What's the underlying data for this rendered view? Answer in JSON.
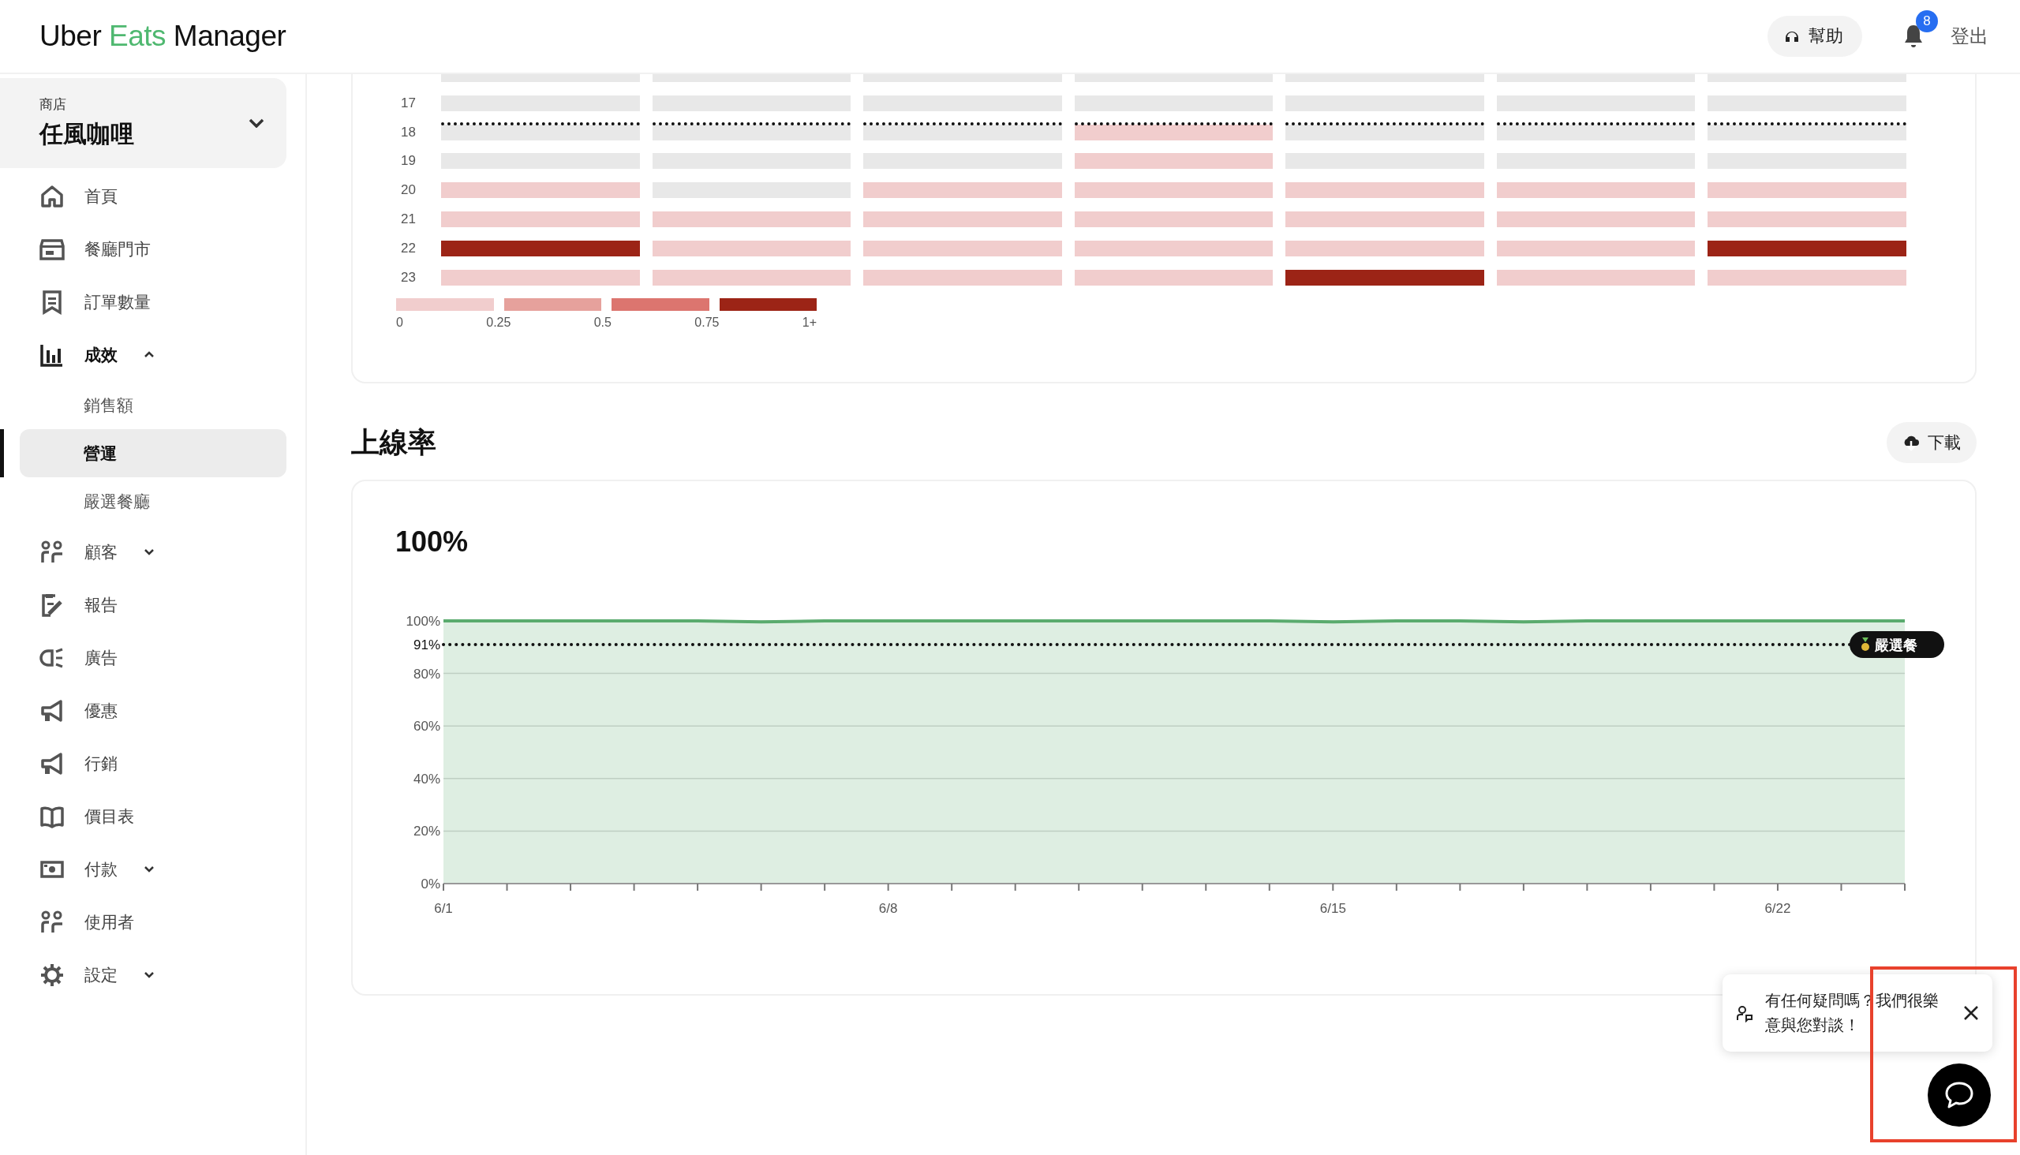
{
  "header": {
    "logo": [
      {
        "text": "Uber",
        "accent": false
      },
      {
        "text": "Eats",
        "accent": true
      },
      {
        "text": "Manager",
        "accent": false
      }
    ],
    "help_button": "幫助",
    "notifications": {
      "count": "8"
    },
    "logout": "登出"
  },
  "sidebar": {
    "store": {
      "label": "商店",
      "name": "任風咖哩"
    },
    "items": [
      {
        "label": "首頁"
      },
      {
        "label": "餐廳門市"
      },
      {
        "label": "訂單數量"
      },
      {
        "label": "成效",
        "expanded": true,
        "children": [
          {
            "label": "銷售額",
            "selected": false
          },
          {
            "label": "營運",
            "selected": true
          },
          {
            "label": "嚴選餐廳",
            "selected": false
          }
        ]
      },
      {
        "label": "顧客",
        "expanded": false
      },
      {
        "label": "報告"
      },
      {
        "label": "廣告"
      },
      {
        "label": "優惠"
      },
      {
        "label": "行銷"
      },
      {
        "label": "價目表"
      },
      {
        "label": "付款",
        "expanded": false
      },
      {
        "label": "使用者"
      },
      {
        "label": "設定",
        "expanded": false
      }
    ]
  },
  "heatmap": {
    "rows": [
      {
        "kind": "partial",
        "threshold": false,
        "cells": [
          {
            "color": "#e8e8e8"
          },
          {
            "color": "#e8e8e8"
          },
          {
            "color": "#e8e8e8"
          },
          {
            "color": "#e8e8e8"
          },
          {
            "color": "#e8e8e8"
          },
          {
            "color": "#e8e8e8"
          },
          {
            "color": "#e8e8e8"
          }
        ]
      },
      {
        "kind": "full",
        "hour": "17",
        "threshold": false,
        "cells": [
          {
            "color": "#e8e8e8"
          },
          {
            "color": "#e8e8e8"
          },
          {
            "color": "#e8e8e8"
          },
          {
            "color": "#e8e8e8"
          },
          {
            "color": "#e8e8e8"
          },
          {
            "color": "#e8e8e8"
          },
          {
            "color": "#e8e8e8"
          }
        ]
      },
      {
        "kind": "full",
        "hour": "18",
        "threshold": true,
        "cells": [
          {
            "color": "#e8e8e8"
          },
          {
            "color": "#e8e8e8"
          },
          {
            "color": "#e8e8e8"
          },
          {
            "color": "#f1cdcd"
          },
          {
            "color": "#e8e8e8"
          },
          {
            "color": "#e8e8e8"
          },
          {
            "color": "#e8e8e8"
          }
        ]
      },
      {
        "kind": "full",
        "hour": "19",
        "threshold": false,
        "cells": [
          {
            "color": "#e8e8e8"
          },
          {
            "color": "#e8e8e8"
          },
          {
            "color": "#e8e8e8"
          },
          {
            "color": "#f1cdcd"
          },
          {
            "color": "#e8e8e8"
          },
          {
            "color": "#e8e8e8"
          },
          {
            "color": "#e8e8e8"
          }
        ]
      },
      {
        "kind": "full",
        "hour": "20",
        "threshold": false,
        "cells": [
          {
            "color": "#f1cdcd"
          },
          {
            "color": "#e8e8e8"
          },
          {
            "color": "#f1cdcd"
          },
          {
            "color": "#f1cdcd"
          },
          {
            "color": "#f1cdcd"
          },
          {
            "color": "#f1cdcd"
          },
          {
            "color": "#f1cdcd"
          }
        ]
      },
      {
        "kind": "full",
        "hour": "21",
        "threshold": false,
        "cells": [
          {
            "color": "#f1cdcd"
          },
          {
            "color": "#f1cdcd"
          },
          {
            "color": "#f1cdcd"
          },
          {
            "color": "#f1cdcd"
          },
          {
            "color": "#f1cdcd"
          },
          {
            "color": "#f1cdcd"
          },
          {
            "color": "#f1cdcd"
          }
        ]
      },
      {
        "kind": "full",
        "hour": "22",
        "threshold": false,
        "cells": [
          {
            "color": "#9c2416"
          },
          {
            "color": "#f1cdcd"
          },
          {
            "color": "#f1cdcd"
          },
          {
            "color": "#f1cdcd"
          },
          {
            "color": "#f1cdcd"
          },
          {
            "color": "#f1cdcd"
          },
          {
            "color": "#9c2416"
          }
        ]
      },
      {
        "kind": "full",
        "hour": "23",
        "threshold": false,
        "cells": [
          {
            "color": "#f1cdcd"
          },
          {
            "color": "#f1cdcd"
          },
          {
            "color": "#f1cdcd"
          },
          {
            "color": "#f1cdcd"
          },
          {
            "color": "#9c2416"
          },
          {
            "color": "#f1cdcd"
          },
          {
            "color": "#f1cdcd"
          }
        ]
      }
    ],
    "legend": {
      "swatches": [
        {
          "color": "#f1cdcd"
        },
        {
          "color": "#e6a19c"
        },
        {
          "color": "#dc756f"
        },
        {
          "color": "#9c2416"
        }
      ],
      "labels": [
        "0",
        "0.25",
        "0.5",
        "0.75",
        "1+"
      ]
    }
  },
  "availability": {
    "title": "上線率",
    "download_button": "下載",
    "value": "100%",
    "chart_data": {
      "type": "line",
      "categories": [
        "6/1",
        null,
        null,
        null,
        null,
        null,
        null,
        "6/8",
        null,
        null,
        null,
        null,
        null,
        null,
        "6/15",
        null,
        null,
        null,
        null,
        null,
        null,
        "6/22",
        null,
        null
      ],
      "series": [
        {
          "color": "#5aab6e",
          "values": [
            100,
            100,
            100,
            100,
            100,
            99.6,
            100,
            100,
            100,
            100,
            100,
            100,
            100,
            100,
            99.6,
            100,
            100,
            99.6,
            100,
            100,
            100,
            100,
            100,
            100
          ]
        }
      ],
      "grid": true,
      "ylim": [
        0,
        100
      ],
      "yticks": [
        {
          "value": 0,
          "label": "0%"
        },
        {
          "value": 20,
          "label": "20%"
        },
        {
          "value": 40,
          "label": "40%"
        },
        {
          "value": 60,
          "label": "60%"
        },
        {
          "value": 80,
          "label": "80%"
        },
        {
          "value": 100,
          "label": "100%"
        }
      ],
      "ref_lines": [
        {
          "axis": "y",
          "value": 91,
          "label": "91%"
        }
      ],
      "annotations": [
        {
          "text": "嚴選餐",
          "y": 91
        }
      ]
    }
  },
  "chat": {
    "message": "有任何疑問嗎？我們很樂意與您對談！",
    "highlighted": true
  }
}
